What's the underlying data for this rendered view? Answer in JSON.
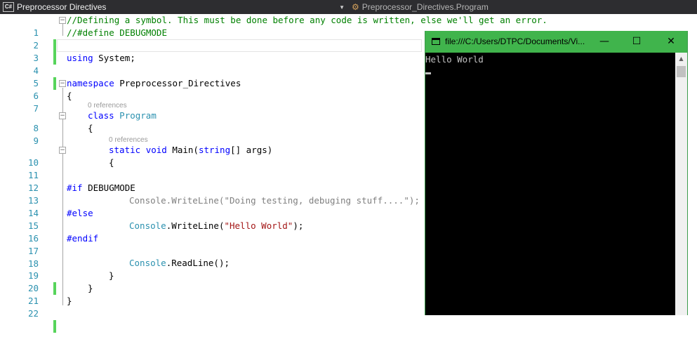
{
  "navbar": {
    "project": "Preprocessor Directives",
    "scope": "Preprocessor_Directives.Program",
    "project_icon": "C#"
  },
  "code_lines": [
    {
      "n": "1",
      "text": "//Defining a symbol. This must be done before any code is written, else we'll get an error."
    },
    {
      "n": "2",
      "text": "//#define DEBUGMODE"
    },
    {
      "n": "3",
      "text": ""
    },
    {
      "n": "4",
      "kw": "using",
      "rest": " System;"
    },
    {
      "n": "5",
      "text": ""
    },
    {
      "n": "6",
      "kw": "namespace",
      "rest": " Preprocessor_Directives"
    },
    {
      "n": "7",
      "text": "{"
    },
    {
      "n": "8",
      "kw": "class",
      "type": "Program"
    },
    {
      "n": "9",
      "text": "{"
    },
    {
      "n": "10",
      "kw1": "static",
      "kw2": "void",
      "name": " Main(",
      "kw3": "string",
      "rest": "[] args)"
    },
    {
      "n": "11",
      "text": "{"
    },
    {
      "n": "12",
      "text": ""
    },
    {
      "n": "13",
      "pp": "#if",
      "rest": " DEBUGMODE"
    },
    {
      "n": "14",
      "text": "Console.WriteLine(\"Doing testing, debuging stuff....\");"
    },
    {
      "n": "15",
      "pp": "#else"
    },
    {
      "n": "16",
      "type": "Console",
      "rest": ".WriteLine(",
      "str": "\"Hello World\"",
      "end": ");"
    },
    {
      "n": "17",
      "pp": "#endif"
    },
    {
      "n": "18",
      "text": ""
    },
    {
      "n": "19",
      "type": "Console",
      "rest": ".ReadLine();"
    },
    {
      "n": "20",
      "text": "}"
    },
    {
      "n": "21",
      "text": "}"
    },
    {
      "n": "22",
      "text": "}"
    }
  ],
  "code_lens": {
    "class_refs": "0 references",
    "main_refs": "0 references"
  },
  "console": {
    "title": "file:///C:/Users/DTPC/Documents/Vi...",
    "output": "Hello World",
    "minimize": "—",
    "maximize": "☐",
    "close": "✕"
  },
  "colors": {
    "keyword": "#0000ff",
    "type": "#2b91af",
    "comment": "#008000",
    "string": "#a31515",
    "change_bar": "#57d45b",
    "console_title": "#40b44c"
  }
}
